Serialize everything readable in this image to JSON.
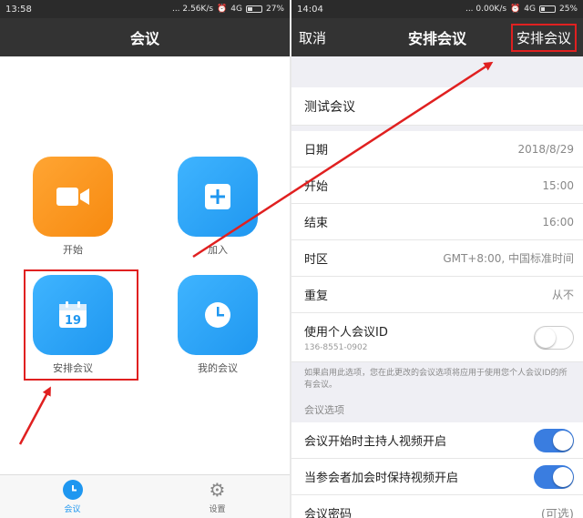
{
  "left": {
    "status": {
      "time": "13:58",
      "net": "... 2.56K/s",
      "signal": "4G",
      "battery": "27%"
    },
    "title": "会议",
    "tiles": [
      {
        "label": "开始",
        "icon": "video-camera-icon",
        "color": "#f7941d"
      },
      {
        "label": "加入",
        "icon": "plus-icon",
        "color": "#1f97f0"
      },
      {
        "label": "安排会议",
        "icon": "calendar-19-icon",
        "color": "#1f97f0",
        "calendar_day": "19"
      },
      {
        "label": "我的会议",
        "icon": "clock-icon",
        "color": "#1f97f0"
      }
    ],
    "tabs": [
      {
        "label": "会议",
        "icon": "clock-icon",
        "active": true
      },
      {
        "label": "设置",
        "icon": "gear-icon",
        "active": false
      }
    ]
  },
  "right": {
    "status": {
      "time": "14:04",
      "net": "... 0.00K/s",
      "signal": "4G",
      "battery": "25%"
    },
    "cancel": "取消",
    "title": "安排会议",
    "confirm": "安排会议",
    "topic": "测试会议",
    "rows": [
      {
        "label": "日期",
        "value": "2018/8/29"
      },
      {
        "label": "开始",
        "value": "15:00"
      },
      {
        "label": "结束",
        "value": "16:00"
      },
      {
        "label": "时区",
        "value": "GMT+8:00, 中国标准时间"
      },
      {
        "label": "重复",
        "value": "从不"
      }
    ],
    "pmi": {
      "label": "使用个人会议ID",
      "id": "136-8551-0902",
      "on": false
    },
    "pmi_note": "如果启用此选项，您在此更改的会议选项将应用于使用您个人会议ID的所有会议。",
    "options_header": "会议选项",
    "host_video": {
      "label": "会议开始时主持人视频开启",
      "on": true
    },
    "participant_video": {
      "label": "当参会者加会时保持视频开启",
      "on": true
    },
    "password": {
      "label": "会议密码",
      "value": "(可选)"
    }
  },
  "colors": {
    "accent": "#1f97f0",
    "highlight": "#e02020",
    "toggle_on": "#3a7de0"
  }
}
